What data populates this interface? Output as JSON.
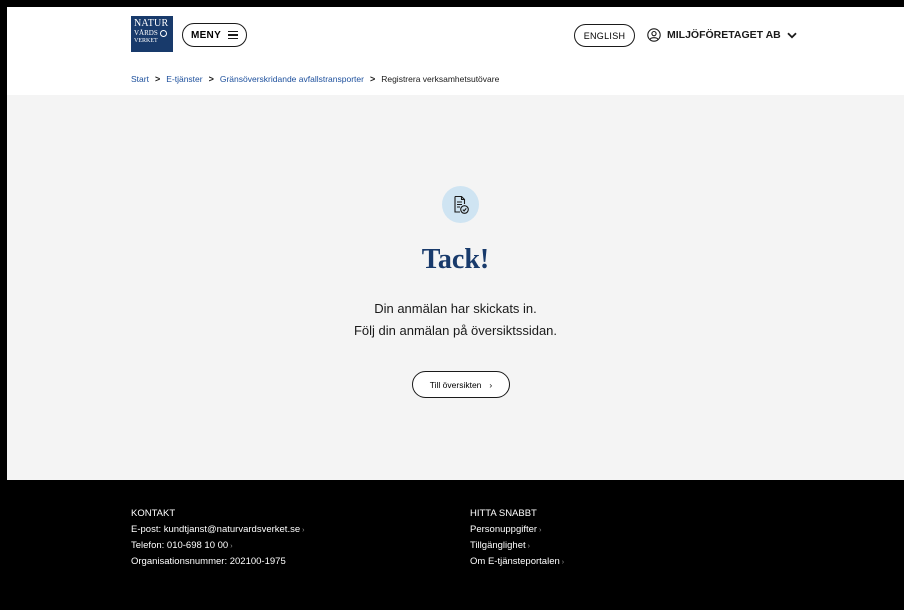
{
  "header": {
    "logo": {
      "line1": "NATUR",
      "line2": "VÅRDS",
      "line3": "VERKET"
    },
    "menu_label": "MENY",
    "english_label": "ENGLISH",
    "account_name": "MILJÖFÖRETAGET AB"
  },
  "breadcrumb": {
    "items": [
      {
        "label": "Start"
      },
      {
        "label": "E-tjänster"
      },
      {
        "label": "Gränsöverskridande avfallstransporter"
      }
    ],
    "current": "Registrera verksamhetsutövare",
    "separator": ">"
  },
  "main": {
    "icon": "document-check-icon",
    "title": "Tack!",
    "message_line1": "Din anmälan har skickats in.",
    "message_line2": "Följ din anmälan på översiktssidan.",
    "button_label": "Till översikten",
    "button_chevron": "›"
  },
  "footer": {
    "contact": {
      "heading": "KONTAKT",
      "email": "E-post: kundtjanst@naturvardsverket.se",
      "phone": "Telefon: 010-698 10 00",
      "org": "Organisationsnummer: 202100-1975"
    },
    "quick": {
      "heading": "HITTA SNABBT",
      "links": [
        "Personuppgifter",
        "Tillgänglighet",
        "Om E-tjänsteportalen"
      ]
    },
    "chevron": "›"
  },
  "colors": {
    "brand_blue": "#183a6b",
    "link_blue": "#1c4f9c",
    "main_bg": "#f4f4f4",
    "icon_circle_bg": "#cfe4f2",
    "footer_bg": "#000000"
  }
}
